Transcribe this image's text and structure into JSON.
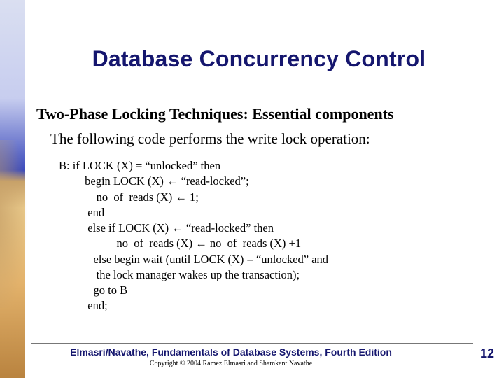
{
  "title": "Database Concurrency Control",
  "subheading": "Two-Phase Locking Techniques: Essential components",
  "intro": "The following code performs the write lock operation:",
  "code": {
    "l1": "B: if LOCK (X) = “unlocked” then",
    "l2": "         begin LOCK (X) ← “read-locked”;",
    "l3": "             no_of_reads (X) ← 1;",
    "l4": "          end",
    "l5": "          else if LOCK (X) ← “read-locked” then",
    "l6": "                    no_of_reads (X) ← no_of_reads (X) +1",
    "l7": "            else begin wait (until LOCK (X) = “unlocked” and",
    "l8": "             the lock manager wakes up the transaction);",
    "l9": "            go to B",
    "l10": "          end;"
  },
  "footer": {
    "text": "Elmasri/Navathe, Fundamentals of Database Systems, Fourth Edition",
    "copyright": "Copyright © 2004 Ramez Elmasri and Shamkant Navathe",
    "page": "12"
  }
}
